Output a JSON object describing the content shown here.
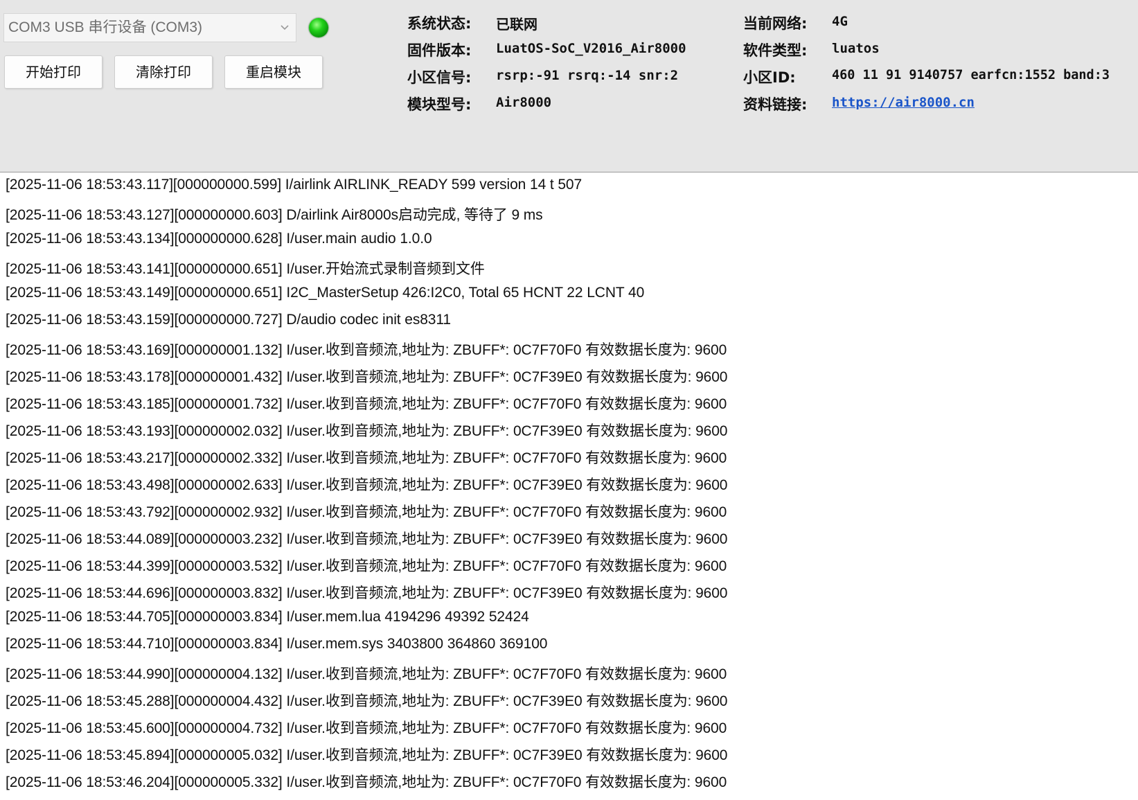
{
  "port_select": {
    "value": "COM3 USB 串行设备 (COM3)",
    "chevron_icon": "chevron-down-icon"
  },
  "status_led": {
    "icon": "status-led-icon",
    "color": "#22d11a"
  },
  "buttons": {
    "start_print": "开始打印",
    "clear_print": "清除打印",
    "restart_module": "重启模块"
  },
  "info": {
    "left": [
      {
        "label": "系统状态:",
        "value": "已联网"
      },
      {
        "label": "固件版本:",
        "value": "LuatOS-SoC_V2016_Air8000"
      },
      {
        "label": "小区信号:",
        "value": "rsrp:-91 rsrq:-14 snr:2"
      },
      {
        "label": "模块型号:",
        "value": "Air8000"
      }
    ],
    "right": [
      {
        "label": "当前网络:",
        "value": "4G"
      },
      {
        "label": "软件类型:",
        "value": "luatos"
      },
      {
        "label": "小区ID:",
        "value": "460 11 91 9140757 earfcn:1552 band:3"
      },
      {
        "label": "资料链接:",
        "value": "https://air8000.cn"
      }
    ]
  },
  "log_lines": [
    "[2025-11-06 18:53:43.117][000000000.599] I/airlink AIRLINK_READY 599 version 14 t 507",
    "[2025-11-06 18:53:43.127][000000000.603] D/airlink Air8000s启动完成, 等待了 9 ms",
    "[2025-11-06 18:53:43.134][000000000.628] I/user.main audio 1.0.0",
    "[2025-11-06 18:53:43.141][000000000.651] I/user.开始流式录制音频到文件",
    "[2025-11-06 18:53:43.149][000000000.651] I2C_MasterSetup 426:I2C0, Total 65 HCNT 22 LCNT 40",
    "[2025-11-06 18:53:43.159][000000000.727] D/audio codec init es8311",
    "[2025-11-06 18:53:43.169][000000001.132] I/user.收到音频流,地址为: ZBUFF*: 0C7F70F0 有效数据长度为: 9600",
    "[2025-11-06 18:53:43.178][000000001.432] I/user.收到音频流,地址为: ZBUFF*: 0C7F39E0 有效数据长度为: 9600",
    "[2025-11-06 18:53:43.185][000000001.732] I/user.收到音频流,地址为: ZBUFF*: 0C7F70F0 有效数据长度为: 9600",
    "[2025-11-06 18:53:43.193][000000002.032] I/user.收到音频流,地址为: ZBUFF*: 0C7F39E0 有效数据长度为: 9600",
    "[2025-11-06 18:53:43.217][000000002.332] I/user.收到音频流,地址为: ZBUFF*: 0C7F70F0 有效数据长度为: 9600",
    "[2025-11-06 18:53:43.498][000000002.633] I/user.收到音频流,地址为: ZBUFF*: 0C7F39E0 有效数据长度为: 9600",
    "[2025-11-06 18:53:43.792][000000002.932] I/user.收到音频流,地址为: ZBUFF*: 0C7F70F0 有效数据长度为: 9600",
    "[2025-11-06 18:53:44.089][000000003.232] I/user.收到音频流,地址为: ZBUFF*: 0C7F39E0 有效数据长度为: 9600",
    "[2025-11-06 18:53:44.399][000000003.532] I/user.收到音频流,地址为: ZBUFF*: 0C7F70F0 有效数据长度为: 9600",
    "[2025-11-06 18:53:44.696][000000003.832] I/user.收到音频流,地址为: ZBUFF*: 0C7F39E0 有效数据长度为: 9600",
    "[2025-11-06 18:53:44.705][000000003.834] I/user.mem.lua 4194296 49392 52424",
    "[2025-11-06 18:53:44.710][000000003.834] I/user.mem.sys 3403800 364860 369100",
    "[2025-11-06 18:53:44.990][000000004.132] I/user.收到音频流,地址为: ZBUFF*: 0C7F70F0 有效数据长度为: 9600",
    "[2025-11-06 18:53:45.288][000000004.432] I/user.收到音频流,地址为: ZBUFF*: 0C7F39E0 有效数据长度为: 9600",
    "[2025-11-06 18:53:45.600][000000004.732] I/user.收到音频流,地址为: ZBUFF*: 0C7F70F0 有效数据长度为: 9600",
    "[2025-11-06 18:53:45.894][000000005.032] I/user.收到音频流,地址为: ZBUFF*: 0C7F39E0 有效数据长度为: 9600",
    "[2025-11-06 18:53:46.204][000000005.332] I/user.收到音频流,地址为: ZBUFF*: 0C7F70F0 有效数据长度为: 9600"
  ]
}
